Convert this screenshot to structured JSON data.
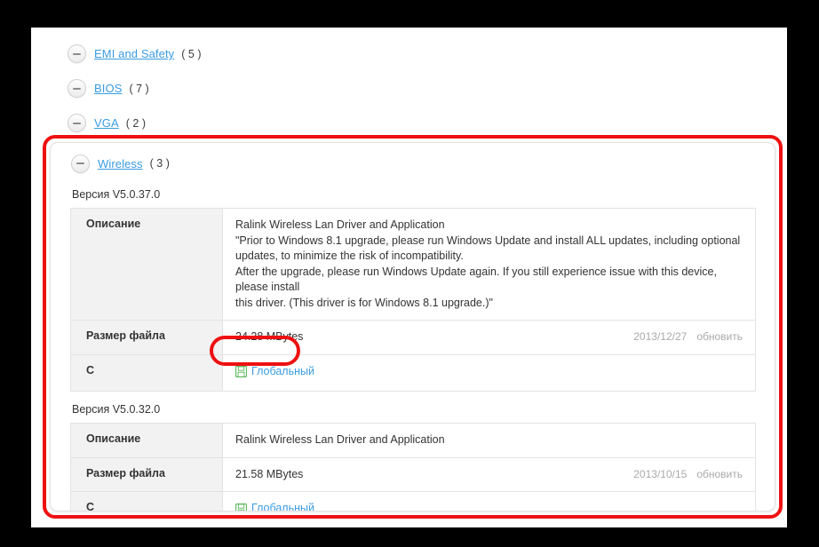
{
  "page": {
    "clipped_top_row_hint": "",
    "categories": [
      {
        "label": "EMI and Safety",
        "count": "( 5 )",
        "icon": "minus-circle-icon"
      },
      {
        "label": "BIOS",
        "count": "( 7 )",
        "icon": "minus-circle-icon"
      },
      {
        "label": "VGA",
        "count": "( 2 )",
        "icon": "minus-circle-icon"
      }
    ]
  },
  "wireless": {
    "label": "Wireless",
    "count": "( 3 )",
    "icon": "minus-circle-icon",
    "versions": [
      {
        "version_label": "Версия V5.0.37.0",
        "rows": {
          "description_label": "Описание",
          "description_lines": [
            "Ralink Wireless Lan Driver and Application",
            "\"Prior to Windows 8.1 upgrade, please run Windows Update and install ALL updates, including optional",
            "updates, to minimize the risk of incompatibility.",
            "After the upgrade, please run Windows Update again. If you still experience issue with this device, please install",
            "this driver. (This driver is for Windows 8.1 upgrade.)\""
          ],
          "filesize_label": "Размер файла",
          "filesize_value": "24.28 MBytes",
          "date": "2013/12/27",
          "update_link": "обновить",
          "download_label": "С",
          "download_link": "Глобальный",
          "download_icon": "floppy-save-icon"
        }
      },
      {
        "version_label": "Версия V5.0.32.0",
        "rows": {
          "description_label": "Описание",
          "description_lines": [
            "Ralink Wireless Lan Driver and Application"
          ],
          "filesize_label": "Размер файла",
          "filesize_value": "21.58 MBytes",
          "date": "2013/10/15",
          "update_link": "обновить",
          "download_label": "С",
          "download_link": "Глобальный",
          "download_icon": "floppy-save-icon"
        }
      }
    ]
  },
  "annotations": {
    "panel_highlight": "red-rounded-rectangle",
    "link_highlight": "red-ellipse"
  },
  "colors": {
    "link_blue": "#3a9ce0",
    "highlight_red": "#ee1111",
    "download_green": "#5cb85c",
    "label_bg": "#f2f2f2",
    "muted_text": "#aaaaaa"
  }
}
